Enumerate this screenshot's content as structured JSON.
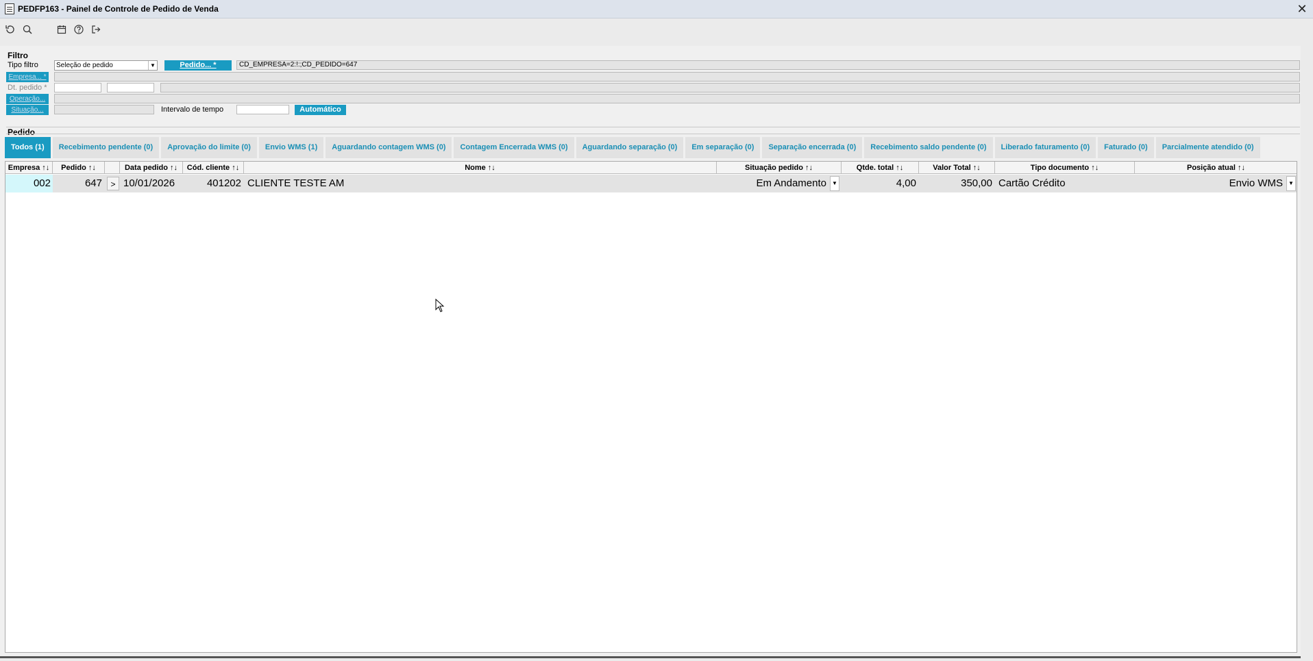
{
  "window": {
    "title": "PEDFP163 - Painel de Controle de Pedido de Venda",
    "close_label": "✕"
  },
  "toolbar": {
    "icons": [
      "refresh-icon",
      "search-icon",
      "calendar-icon",
      "help-icon",
      "exit-icon"
    ]
  },
  "filter": {
    "section_label": "Filtro",
    "tipo_filtro_label": "Tipo filtro",
    "tipo_filtro_value": "Seleção de pedido",
    "pedido_button": "Pedido... *",
    "pedido_value": "CD_EMPRESA=2:!:;CD_PEDIDO=647",
    "empresa_button": "Empresa... *",
    "dt_pedido_label": "Dt. pedido *",
    "operacao_button": "Operação...",
    "situacao_button": "Situação...",
    "intervalo_label": "Intervalo de tempo",
    "automatico_button": "Automático"
  },
  "pedido": {
    "section_label": "Pedido",
    "tabs": [
      "Todos (1)",
      "Recebimento pendente (0)",
      "Aprovação do limite (0)",
      "Envio WMS (1)",
      "Aguardando contagem WMS (0)",
      "Contagem Encerrada WMS (0)",
      "Aguardando separação (0)",
      "Em separação (0)",
      "Separação encerrada (0)",
      "Recebimento saldo pendente (0)",
      "Liberado faturamento (0)",
      "Faturado (0)",
      "Parcialmente atendido (0)"
    ],
    "active_tab": "Todos (1)"
  },
  "grid": {
    "columns": [
      "Empresa ↑↓",
      "Pedido ↑↓",
      "",
      "Data pedido ↑↓",
      "Cód. cliente ↑↓",
      "Nome ↑↓",
      "Situação pedido ↑↓",
      "Qtde. total ↑↓",
      "Valor Total ↑↓",
      "Tipo documento ↑↓",
      "Posição atual ↑↓"
    ],
    "rows": [
      {
        "empresa": "002",
        "pedido": "647",
        "expand": ">",
        "data_pedido": "10/01/2026",
        "cod_cliente": "401202",
        "nome": "CLIENTE TESTE AM",
        "situacao": "Em Andamento",
        "qtde_total": "4,00",
        "valor_total": "350,00",
        "tipo_documento": "Cartão Crédito",
        "posicao_atual": "Envio WMS"
      }
    ]
  },
  "colors": {
    "accent": "#1a9bc2",
    "tab_text": "#1a8fb5",
    "title_bg": "#dde3ec",
    "highlight_cell": "#d4f7fb"
  }
}
